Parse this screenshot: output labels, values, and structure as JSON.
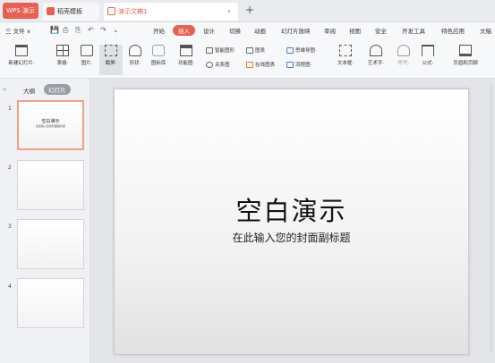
{
  "tabs": {
    "wps": "WPS 演示",
    "template": "稻壳模板",
    "doc": "演示文稿1",
    "close": "•",
    "add": "+"
  },
  "menu": {
    "file": "三 文件 ∨",
    "quick_icons": [
      "💾",
      "⎙",
      "⎘",
      "↶",
      "↷",
      "⌄"
    ],
    "items": [
      "开始",
      "插入",
      "设计",
      "切换",
      "动画",
      "幻灯片放映",
      "审阅",
      "视图",
      "安全",
      "开发工具",
      "特色应用",
      "文稿"
    ]
  },
  "ribbon": {
    "big": [
      "新建幻灯片·",
      "表格·",
      "图片·",
      "截屏·",
      "形状·",
      "图标库",
      "功能图·"
    ],
    "right_big": [
      "文本框·",
      "艺术字·",
      "符号·",
      "公式·",
      "页眉和页脚"
    ],
    "small": [
      "智能图形",
      "图表",
      "关系图",
      "在线图表",
      "思维导图·",
      "流程图·"
    ]
  },
  "left": {
    "collapse": "«",
    "outline": "大纲",
    "slides": "幻灯片",
    "numbers": [
      "1",
      "2",
      "3",
      "4"
    ],
    "thumb1_title": "空白演示",
    "thumb1_sub": "在此输入您的封面副标题"
  },
  "slide": {
    "title": "空白演示",
    "subtitle": "在此输入您的封面副标题"
  },
  "colors": {
    "accent": "#e8604f",
    "tab_bg": "#e9ebee"
  }
}
